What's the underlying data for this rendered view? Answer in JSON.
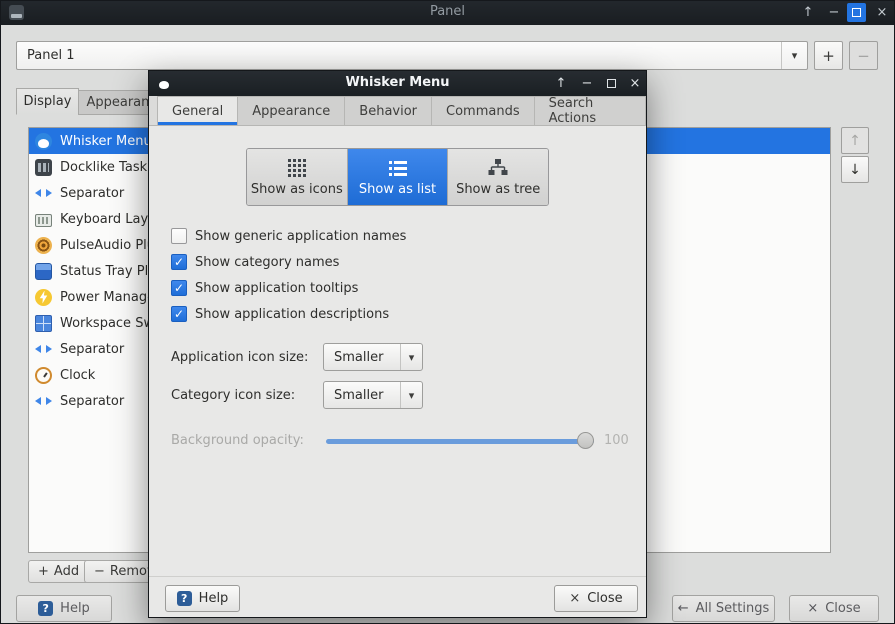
{
  "colors": {
    "accent": "#2374e1",
    "titlebar_bg": "#1d2126"
  },
  "icons": {
    "shade": "↑",
    "minimize": "−",
    "close": "×",
    "up": "↑",
    "down": "↓",
    "plus": "+",
    "minus": "−",
    "arrow_down": "▾",
    "check": "✓",
    "question": "?",
    "back": "←",
    "cross": "×"
  },
  "main_window": {
    "title": "Panel",
    "panel_selector": {
      "value": "Panel 1"
    },
    "tabs": [
      {
        "label": "Display"
      },
      {
        "label": "Appearance"
      }
    ],
    "items": [
      {
        "label": "Whisker Menu",
        "selected": true
      },
      {
        "label": "Docklike Taskbar"
      },
      {
        "label": "Separator"
      },
      {
        "label": "Keyboard Layouts"
      },
      {
        "label": "PulseAudio Plugin"
      },
      {
        "label": "Status Tray Plugin"
      },
      {
        "label": "Power Manager Plugin"
      },
      {
        "label": "Workspace Switcher"
      },
      {
        "label": "Separator"
      },
      {
        "label": "Clock"
      },
      {
        "label": "Separator"
      }
    ],
    "add_label": "Add",
    "remove_label": "Remove",
    "help_label": "Help",
    "all_settings_label": "All Settings",
    "close_label": "Close"
  },
  "dialog": {
    "title": "Whisker Menu",
    "tabs": [
      {
        "label": "General",
        "active": true
      },
      {
        "label": "Appearance"
      },
      {
        "label": "Behavior"
      },
      {
        "label": "Commands"
      },
      {
        "label": "Search Actions"
      }
    ],
    "view_modes": [
      {
        "label": "Show as icons"
      },
      {
        "label": "Show as list",
        "selected": true
      },
      {
        "label": "Show as tree"
      }
    ],
    "options": [
      {
        "label": "Show generic application names",
        "checked": false
      },
      {
        "label": "Show category names",
        "checked": true
      },
      {
        "label": "Show application tooltips",
        "checked": true
      },
      {
        "label": "Show application descriptions",
        "checked": true
      }
    ],
    "app_icon_size": {
      "label": "Application icon size:",
      "value": "Smaller"
    },
    "cat_icon_size": {
      "label": "Category icon size:",
      "value": "Smaller"
    },
    "opacity": {
      "label": "Background opacity:",
      "value": "100"
    },
    "help_label": "Help",
    "close_label": "Close"
  }
}
